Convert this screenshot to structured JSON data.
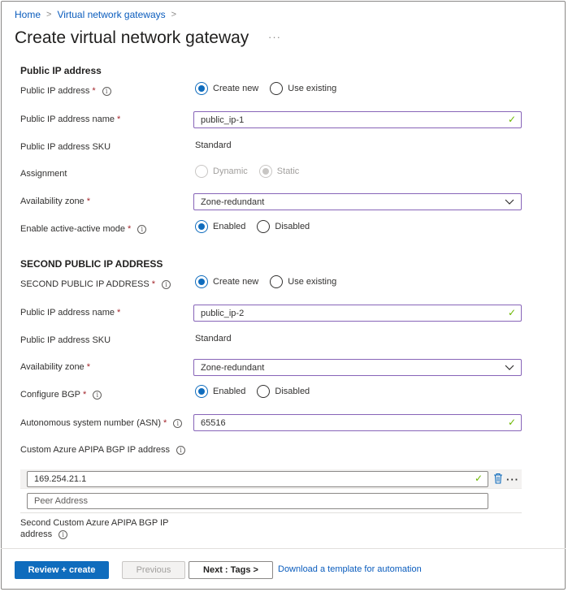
{
  "breadcrumb": {
    "home": "Home",
    "parent": "Virtual network gateways",
    "sep": ">"
  },
  "page": {
    "title": "Create virtual network gateway",
    "more": "···"
  },
  "section1": {
    "heading": "Public IP address",
    "public_ip": {
      "label": "Public IP address",
      "required": "*",
      "options": [
        "Create new",
        "Use existing"
      ],
      "selected": "Create new"
    },
    "ip_name": {
      "label": "Public IP address name",
      "required": "*",
      "value": "public_ip-1"
    },
    "sku": {
      "label": "Public IP address SKU",
      "value": "Standard"
    },
    "assignment": {
      "label": "Assignment",
      "options": [
        "Dynamic",
        "Static"
      ],
      "selected": "Static"
    },
    "zone": {
      "label": "Availability zone",
      "required": "*",
      "value": "Zone-redundant"
    },
    "active_active": {
      "label": "Enable active-active mode",
      "required": "*",
      "options": [
        "Enabled",
        "Disabled"
      ],
      "selected": "Enabled"
    }
  },
  "section2": {
    "heading": "SECOND PUBLIC IP ADDRESS",
    "public_ip": {
      "label": "SECOND PUBLIC IP ADDRESS",
      "required": "*",
      "options": [
        "Create new",
        "Use existing"
      ],
      "selected": "Create new"
    },
    "ip_name": {
      "label": "Public IP address name",
      "required": "*",
      "value": "public_ip-2"
    },
    "sku": {
      "label": "Public IP address SKU",
      "value": "Standard"
    },
    "zone": {
      "label": "Availability zone",
      "required": "*",
      "value": "Zone-redundant"
    },
    "bgp": {
      "label": "Configure BGP",
      "required": "*",
      "options": [
        "Enabled",
        "Disabled"
      ],
      "selected": "Enabled"
    },
    "asn": {
      "label": "Autonomous system number (ASN)",
      "required": "*",
      "value": "65516"
    },
    "apipa": {
      "label": "Custom Azure APIPA BGP IP address",
      "value": "169.254.21.1",
      "peer_placeholder": "Peer Address"
    },
    "second_apipa": {
      "label_line1": "Second Custom Azure APIPA BGP IP",
      "label_line2": "address"
    }
  },
  "footer": {
    "review_create": "Review + create",
    "previous": "Previous",
    "next": "Next : Tags >",
    "download_link": "Download a template for automation"
  },
  "colors": {
    "accent": "#0f6cbd",
    "valid": "#6bb700",
    "field_border": "#8764b8",
    "required": "#a4262c",
    "link": "#0a5cbd"
  }
}
